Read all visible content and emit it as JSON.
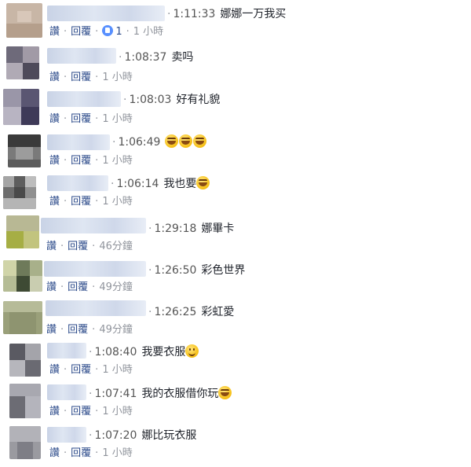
{
  "actions": {
    "like": "讚",
    "reply": "回覆"
  },
  "comments": [
    {
      "time": "1:11:33",
      "text": "娜娜一万我买",
      "emojis": [],
      "like_count": "1",
      "age": "1 小時"
    },
    {
      "time": "1:08:37",
      "text": "卖吗",
      "emojis": [],
      "like_count": "",
      "age": "1 小時"
    },
    {
      "time": "1:08:03",
      "text": "好有礼貌",
      "emojis": [],
      "like_count": "",
      "age": "1 小時"
    },
    {
      "time": "1:06:49",
      "text": "",
      "emojis": [
        "laughing-emoji",
        "laughing-emoji",
        "laughing-emoji"
      ],
      "like_count": "",
      "age": "1 小時"
    },
    {
      "time": "1:06:14",
      "text": "我也要",
      "emojis": [
        "laughing-emoji"
      ],
      "like_count": "",
      "age": "1 小時"
    },
    {
      "time": "1:29:18",
      "text": "娜畢卡",
      "emojis": [],
      "like_count": "",
      "age": "46分鐘"
    },
    {
      "time": "1:26:50",
      "text": "彩色世界",
      "emojis": [],
      "like_count": "",
      "age": "49分鐘"
    },
    {
      "time": "1:26:25",
      "text": "彩虹愛",
      "emojis": [],
      "like_count": "",
      "age": "49分鐘"
    },
    {
      "time": "1:08:40",
      "text": "我要衣服",
      "emojis": [
        "smiling-emoji"
      ],
      "like_count": "",
      "age": "1 小時"
    },
    {
      "time": "1:07:41",
      "text": "我的衣服借你玩",
      "emojis": [
        "laughing-emoji"
      ],
      "like_count": "",
      "age": "1 小時"
    },
    {
      "time": "1:07:20",
      "text": "娜比玩衣服",
      "emojis": [],
      "like_count": "",
      "age": "1 小時"
    }
  ]
}
